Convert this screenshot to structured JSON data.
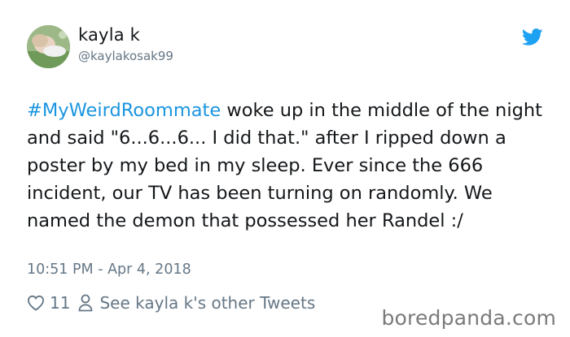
{
  "user": {
    "display_name": "kayla k",
    "handle": "@kaylakosak99"
  },
  "tweet": {
    "hashtag": "#MyWeirdRoommate",
    "body": " woke up in the middle of the night and said \"6...6...6... I did that.\" after I ripped down a poster by my bed in my sleep. Ever since the 666 incident, our TV has been turning on randomly. We named the demon that possessed her Randel :/",
    "timestamp": "10:51 PM - Apr 4, 2018"
  },
  "actions": {
    "like_count": "11",
    "other_tweets_label": "See kayla k's other Tweets"
  },
  "icons": {
    "like": "heart-icon",
    "profile": "person-icon",
    "brand": "twitter-bird-icon"
  },
  "colors": {
    "hashtag": "#1b95e0",
    "brand": "#1da1f2",
    "secondary_text": "#657786"
  },
  "watermark": "boredpanda.com"
}
